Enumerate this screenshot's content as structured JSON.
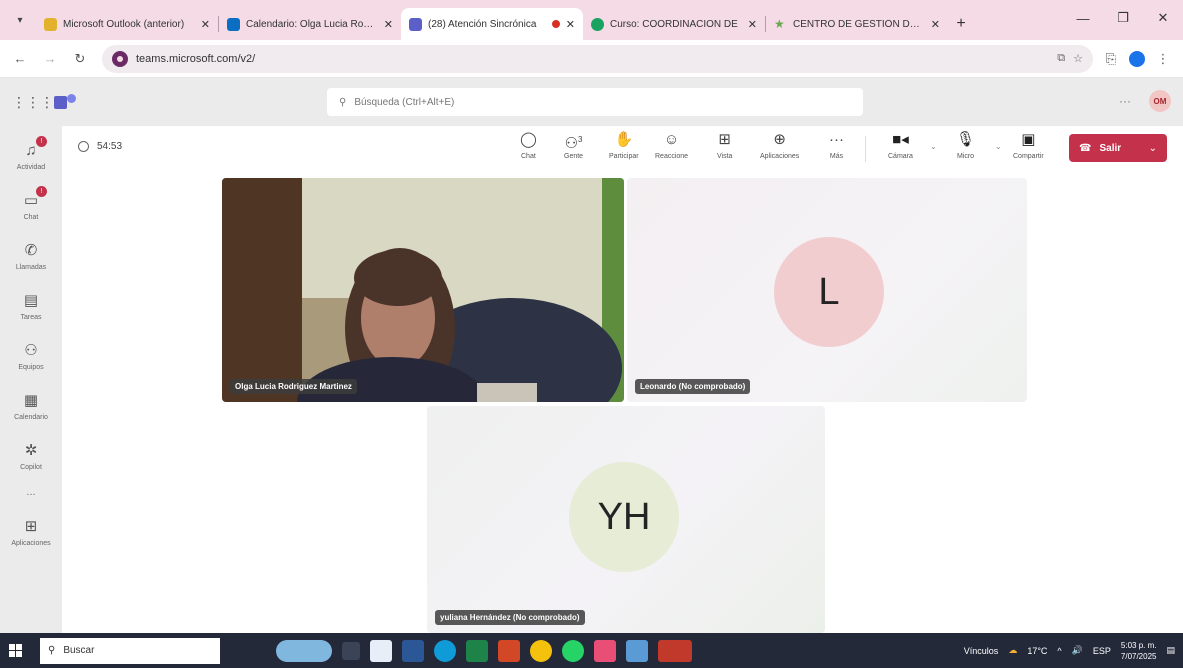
{
  "browser": {
    "tabs": [
      {
        "title": "Microsoft Outlook (anterior)",
        "favicon_color": "#e3b22c",
        "active": false,
        "recording": false
      },
      {
        "title": "Calendario: Olga Lucia Rodriguez",
        "favicon_color": "#0a6fc2",
        "active": false,
        "recording": false
      },
      {
        "title": "(28) Atención Sincrónica",
        "favicon_color": "#5b5fc7",
        "active": true,
        "recording": true
      },
      {
        "title": "Curso: COORDINACION DE",
        "favicon_color": "#1aa260",
        "active": false,
        "recording": false
      },
      {
        "title": "CENTRO DE GESTIÓN DE M",
        "favicon_color": "#6aa84f",
        "active": false,
        "recording": false
      }
    ],
    "url": "teams.microsoft.com/v2/"
  },
  "teams": {
    "search_placeholder": "Búsqueda (Ctrl+Alt+E)",
    "user_initials": "OM"
  },
  "rail": {
    "items": [
      {
        "label": "Actividad",
        "badge": "!"
      },
      {
        "label": "Chat",
        "badge": "!"
      },
      {
        "label": "Llamadas",
        "badge": ""
      },
      {
        "label": "Tareas",
        "badge": ""
      },
      {
        "label": "Equipos",
        "badge": ""
      },
      {
        "label": "Calendario",
        "badge": ""
      },
      {
        "label": "Copilot",
        "badge": ""
      },
      {
        "label": "...",
        "badge": ""
      },
      {
        "label": "Aplicaciones",
        "badge": ""
      }
    ]
  },
  "meeting": {
    "timer": "54:53",
    "controls": {
      "chat": "Chat",
      "people": "Gente",
      "people_count": "3",
      "raise": "Participar",
      "react": "Reaccione",
      "view": "Vista",
      "apps": "Aplicaciones",
      "more": "Más",
      "camera": "Cámara",
      "mic": "Micro",
      "share": "Compartir"
    },
    "leave_label": "Salir",
    "participants": [
      {
        "name": "Olga Lucia Rodriguez Martinez",
        "initials": "",
        "video": true
      },
      {
        "name": "Leonardo (No comprobado)",
        "initials": "L",
        "video": false,
        "avatar_color": "#f1cdd0"
      },
      {
        "name": "yuliana Hernández (No comprobado)",
        "initials": "YH",
        "video": false,
        "avatar_color": "#e6ecd6"
      }
    ]
  },
  "taskbar": {
    "search_label": "Buscar",
    "weather_label": "Vínculos",
    "temperature": "17°C",
    "language": "ESP",
    "time": "5:03 p. m.",
    "date": "7/07/2025"
  }
}
